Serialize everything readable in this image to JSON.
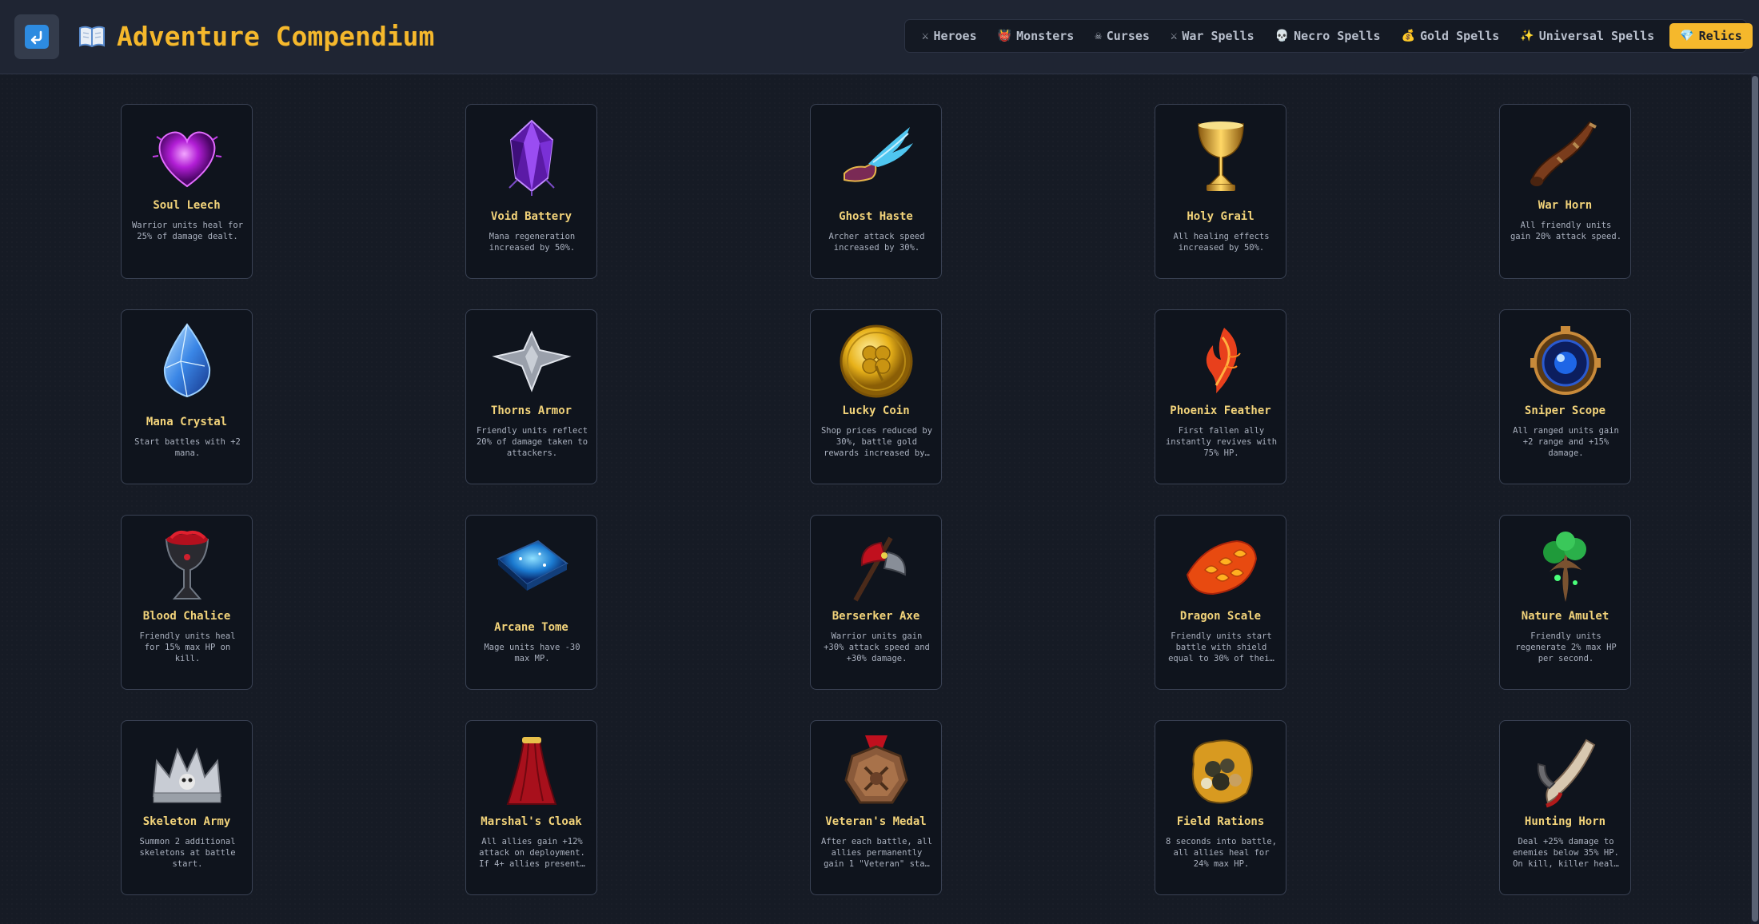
{
  "header": {
    "title": "Adventure Compendium",
    "back_icon": "return-arrow-icon",
    "title_icon": "open-book-icon",
    "accent_color": "#f5b82c"
  },
  "nav": {
    "tabs": [
      {
        "label": "Heroes",
        "icon": "crossed-swords-icon",
        "glyph": "⚔"
      },
      {
        "label": "Monsters",
        "icon": "demon-face-icon",
        "glyph": "👹"
      },
      {
        "label": "Curses",
        "icon": "skull-crossbones-icon",
        "glyph": "☠"
      },
      {
        "label": "War Spells",
        "icon": "crossed-swords-icon",
        "glyph": "⚔"
      },
      {
        "label": "Necro Spells",
        "icon": "skull-icon",
        "glyph": "💀"
      },
      {
        "label": "Gold Spells",
        "icon": "money-bag-icon",
        "glyph": "💰"
      },
      {
        "label": "Universal Spells",
        "icon": "sparkles-icon",
        "glyph": "✨"
      },
      {
        "label": "Relics",
        "icon": "gem-icon",
        "glyph": "💎",
        "active": true
      }
    ]
  },
  "relics": [
    {
      "name": "Soul Leech",
      "desc": "Warrior units heal for 25% of damage dealt.",
      "icon": "purple-heart-icon"
    },
    {
      "name": "Void Battery",
      "desc": "Mana regeneration increased by 50%.",
      "icon": "purple-crystal-icon"
    },
    {
      "name": "Ghost Haste",
      "desc": "Archer attack speed increased by 30%.",
      "icon": "winged-boot-icon"
    },
    {
      "name": "Holy Grail",
      "desc": "All healing effects increased by 50%.",
      "icon": "golden-chalice-icon"
    },
    {
      "name": "War Horn",
      "desc": "All friendly units gain 20% attack speed.",
      "icon": "war-horn-icon"
    },
    {
      "name": "Mana Crystal",
      "desc": "Start battles with +2 mana.",
      "icon": "blue-crystal-icon"
    },
    {
      "name": "Thorns Armor",
      "desc": "Friendly units reflect 20% of damage taken to attackers.",
      "icon": "spiked-armor-icon"
    },
    {
      "name": "Lucky Coin",
      "desc": "Shop prices reduced by 30%, battle gold rewards increased by…",
      "icon": "clover-coin-icon"
    },
    {
      "name": "Phoenix Feather",
      "desc": "First fallen ally instantly revives with 75% HP.",
      "icon": "flame-feather-icon"
    },
    {
      "name": "Sniper Scope",
      "desc": "All ranged units gain +2 range and +15% damage.",
      "icon": "scope-lens-icon"
    },
    {
      "name": "Blood Chalice",
      "desc": "Friendly units heal for 15% max HP on kill.",
      "icon": "blood-chalice-icon"
    },
    {
      "name": "Arcane Tome",
      "desc": "Mage units have -30 max MP.",
      "icon": "arcane-book-icon"
    },
    {
      "name": "Berserker Axe",
      "desc": "Warrior units gain +30% attack speed and +30% damage.",
      "icon": "red-axe-icon"
    },
    {
      "name": "Dragon Scale",
      "desc": "Friendly units start battle with shield equal to 30% of thei…",
      "icon": "dragon-scale-icon"
    },
    {
      "name": "Nature Amulet",
      "desc": "Friendly units regenerate 2% max HP per second.",
      "icon": "tree-amulet-icon"
    },
    {
      "name": "Skeleton Army",
      "desc": "Summon 2 additional skeletons at battle start.",
      "icon": "skull-crown-icon"
    },
    {
      "name": "Marshal's Cloak",
      "desc": "All allies gain +12% attack on deployment. If 4+ allies present…",
      "icon": "red-cloak-icon"
    },
    {
      "name": "Veteran's Medal",
      "desc": "After each battle, all allies permanently gain 1 \"Veteran\" sta…",
      "icon": "bronze-medal-icon"
    },
    {
      "name": "Field Rations",
      "desc": "8 seconds into battle, all allies heal for 24% max HP.",
      "icon": "ration-sack-icon"
    },
    {
      "name": "Hunting Horn",
      "desc": "Deal +25% damage to enemies below 35% HP. On kill, killer heal…",
      "icon": "hunting-horn-icon"
    }
  ]
}
